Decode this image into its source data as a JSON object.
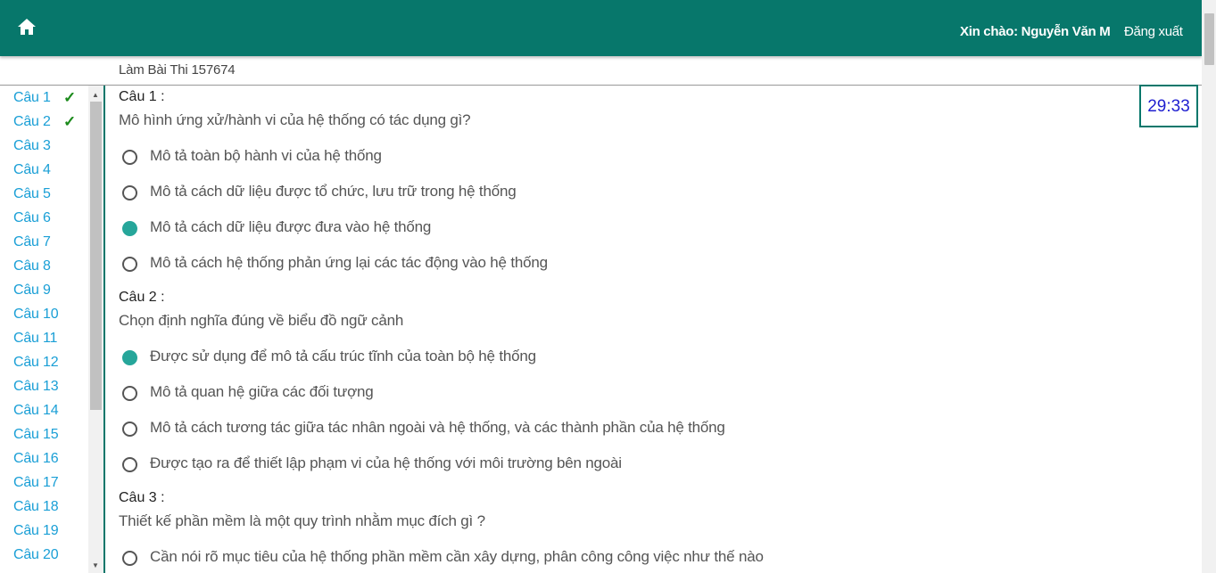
{
  "header": {
    "greeting": "Xin chào: Nguyễn Văn M",
    "logout_label": "Đăng xuất",
    "home_icon": "home-icon"
  },
  "breadcrumb": "Làm Bài Thi 157674",
  "timer": "29:33",
  "sidebar": {
    "items": [
      {
        "label": "Câu 1",
        "answered": true
      },
      {
        "label": "Câu 2",
        "answered": true
      },
      {
        "label": "Câu 3",
        "answered": false
      },
      {
        "label": "Câu 4",
        "answered": false
      },
      {
        "label": "Câu 5",
        "answered": false
      },
      {
        "label": "Câu 6",
        "answered": false
      },
      {
        "label": "Câu 7",
        "answered": false
      },
      {
        "label": "Câu 8",
        "answered": false
      },
      {
        "label": "Câu 9",
        "answered": false
      },
      {
        "label": "Câu 10",
        "answered": false
      },
      {
        "label": "Câu 11",
        "answered": false
      },
      {
        "label": "Câu 12",
        "answered": false
      },
      {
        "label": "Câu 13",
        "answered": false
      },
      {
        "label": "Câu 14",
        "answered": false
      },
      {
        "label": "Câu 15",
        "answered": false
      },
      {
        "label": "Câu 16",
        "answered": false
      },
      {
        "label": "Câu 17",
        "answered": false
      },
      {
        "label": "Câu 18",
        "answered": false
      },
      {
        "label": "Câu 19",
        "answered": false
      },
      {
        "label": "Câu 20",
        "answered": false
      }
    ],
    "check_mark": "✓"
  },
  "questions": [
    {
      "label": "Câu 1 :",
      "text": "Mô hình ứng xử/hành vi của hệ thống có tác dụng gì?",
      "options": [
        {
          "text": "Mô tả toàn bộ hành vi của hệ thống",
          "selected": false
        },
        {
          "text": "Mô tả cách dữ liệu được tổ chức, lưu trữ trong hệ thống",
          "selected": false
        },
        {
          "text": "Mô tả cách dữ liệu được đưa vào hệ thống",
          "selected": true
        },
        {
          "text": "Mô tả cách hệ thống phản ứng lại các tác động vào hệ thống",
          "selected": false
        }
      ]
    },
    {
      "label": "Câu 2 :",
      "text": "Chọn định nghĩa đúng về biểu đồ ngữ cảnh",
      "options": [
        {
          "text": "Được sử dụng để mô tả cấu trúc tĩnh của toàn bộ hệ thống",
          "selected": true
        },
        {
          "text": "Mô tả quan hệ giữa các đối tượng",
          "selected": false
        },
        {
          "text": "Mô tả cách tương tác giữa tác nhân ngoài và hệ thống, và các thành phần của hệ thống",
          "selected": false
        },
        {
          "text": "Được tạo ra để thiết lập phạm vi của hệ thống với môi trường bên ngoài",
          "selected": false
        }
      ]
    },
    {
      "label": "Câu 3 :",
      "text": "Thiết kế phần mềm là một quy trình nhằm mục đích gì ?",
      "options": [
        {
          "text": "Cần nói rõ mục tiêu của hệ thống phần mềm cần xây dựng, phân công công việc như thế nào",
          "selected": false
        }
      ]
    }
  ],
  "colors": {
    "header_bg": "#07776b",
    "radio_checked": "#26a69a",
    "sidebar_link": "#1a9fd6",
    "check": "#1b8a1b",
    "timer_text": "#1f1fd0"
  }
}
